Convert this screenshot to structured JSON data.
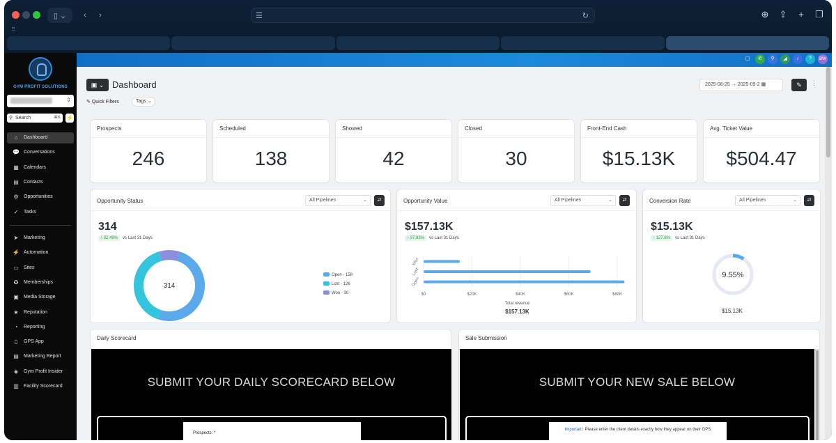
{
  "browser": {
    "tabs": [
      "",
      "",
      "",
      "",
      ""
    ]
  },
  "sidebar": {
    "brand": "GYM PROFIT SOLUTIONS",
    "search_placeholder": "Search",
    "search_shortcut": "⌘K",
    "items_top": [
      {
        "label": "Dashboard",
        "icon": "home-icon",
        "glyph": "⌂",
        "active": true
      },
      {
        "label": "Conversations",
        "icon": "chat-icon",
        "glyph": "💬",
        "active": false
      },
      {
        "label": "Calendars",
        "icon": "calendar-icon",
        "glyph": "▦",
        "active": false
      },
      {
        "label": "Contacts",
        "icon": "contacts-icon",
        "glyph": "▤",
        "active": false
      },
      {
        "label": "Opportunities",
        "icon": "opportunities-icon",
        "glyph": "⚙",
        "active": false
      },
      {
        "label": "Tasks",
        "icon": "check-icon",
        "glyph": "✓",
        "active": false
      }
    ],
    "items_bottom": [
      {
        "label": "Marketing",
        "icon": "send-icon",
        "glyph": "➤"
      },
      {
        "label": "Automation",
        "icon": "automation-icon",
        "glyph": "⚡"
      },
      {
        "label": "Sites",
        "icon": "sites-icon",
        "glyph": "▭"
      },
      {
        "label": "Memberships",
        "icon": "memberships-icon",
        "glyph": "✪"
      },
      {
        "label": "Media Storage",
        "icon": "media-icon",
        "glyph": "▣"
      },
      {
        "label": "Reputation",
        "icon": "reputation-icon",
        "glyph": "★"
      },
      {
        "label": "Reporting",
        "icon": "reporting-icon",
        "glyph": "◔"
      },
      {
        "label": "GPS App",
        "icon": "app-icon",
        "glyph": "▯"
      },
      {
        "label": "Marketing Report",
        "icon": "report-icon",
        "glyph": "▤"
      },
      {
        "label": "Gym Profit Insider",
        "icon": "insider-icon",
        "glyph": "◈"
      },
      {
        "label": "Facility Scorecard",
        "icon": "scorecard-icon",
        "glyph": "▥"
      }
    ]
  },
  "topbar": {
    "avatar_initials": "BW"
  },
  "header": {
    "title": "Dashboard",
    "quick_filters": "Quick Filters",
    "tags": "Tags",
    "date_range": "2025-08-25  →  2025-09-2"
  },
  "stats": [
    {
      "label": "Prospects",
      "value": "246"
    },
    {
      "label": "Scheduled",
      "value": "138"
    },
    {
      "label": "Showed",
      "value": "42"
    },
    {
      "label": "Closed",
      "value": "30"
    },
    {
      "label": "Front-End Cash",
      "value": "$15.13K"
    },
    {
      "label": "Avg. Ticket Value",
      "value": "$504.47"
    }
  ],
  "panels": {
    "opportunity_status": {
      "title": "Opportunity Status",
      "select": "All Pipelines",
      "total": "314",
      "trend_pct": "↑ 32.49%",
      "trend_text": "vs Last 31 Days",
      "center_label": "314"
    },
    "opportunity_value": {
      "title": "Opportunity Value",
      "select": "All Pipelines",
      "total": "$157.13K",
      "trend_pct": "↑ 37.93%",
      "trend_text": "vs Last 31 Days",
      "axis_title": "Total revenue",
      "axis_total": "$157.13K"
    },
    "conversion_rate": {
      "title": "Conversion Rate",
      "select": "All Pipelines",
      "total": "$15.13K",
      "trend_pct": "↑ 127.8%",
      "trend_text": "vs Last 31 Days",
      "gauge_label": "9.55%",
      "gauge_value": 9.55,
      "footer": "$15.13K"
    },
    "daily_scorecard": {
      "title": "Daily Scorecard",
      "banner": "SUBMIT YOUR DAILY SCORECARD BELOW",
      "field_label": "Prospects: *"
    },
    "sale_submission": {
      "title": "Sale Submission",
      "banner": "SUBMIT YOUR NEW SALE BELOW",
      "important_label": "Important:",
      "important_text": " Please enter the client details exactly how they appear on their GPS"
    }
  },
  "chart_data": [
    {
      "type": "pie",
      "title": "Opportunity Status",
      "categories": [
        "Open - 158",
        "Lost - 126",
        "Won - 30"
      ],
      "values": [
        158,
        126,
        30
      ],
      "colors": [
        "#5aa9ea",
        "#35c4dd",
        "#8b8fdc"
      ],
      "legend": "right"
    },
    {
      "type": "bar",
      "title": "Opportunity Value",
      "orientation": "horizontal",
      "categories": [
        "Won",
        "Lost",
        "Open"
      ],
      "values": [
        15000,
        69000,
        83000
      ],
      "xlabel": "Total revenue",
      "xticks": [
        "$0",
        "$20K",
        "$40K",
        "$60K",
        "$80K"
      ],
      "xlim": [
        0,
        80000
      ],
      "color": "#5aa9ea"
    }
  ],
  "colors": {
    "accent": "#1d8ad9",
    "bar": "#5aa9ea",
    "open": "#5aa9ea",
    "lost": "#35c4dd",
    "won": "#8b8fdc"
  }
}
